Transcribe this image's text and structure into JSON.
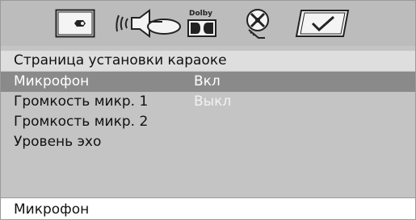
{
  "tabs": {
    "general": {
      "icon": "wrench-icon"
    },
    "audio": {
      "icon": "speaker-icon"
    },
    "dolby": {
      "icon": "dolby-icon",
      "text": "Dolby"
    },
    "video": {
      "icon": "video-reel-icon"
    },
    "preferences": {
      "icon": "checkmark-icon"
    }
  },
  "menu": {
    "title": "Страница установки караоке",
    "items": [
      {
        "label": "Микрофон",
        "value": "Вкл"
      },
      {
        "label": "Громкость микр. 1",
        "value": "Выкл"
      },
      {
        "label": "Громкость микр. 2",
        "value": ""
      },
      {
        "label": "Уровень эхо",
        "value": ""
      }
    ]
  },
  "status": {
    "text": "Микрофон"
  },
  "colors": {
    "tabbar_bg": "#bcbcbc",
    "menu_bg": "#c4c4c4",
    "title_bg": "#dedede",
    "highlight_bg": "#8a8a8a"
  }
}
